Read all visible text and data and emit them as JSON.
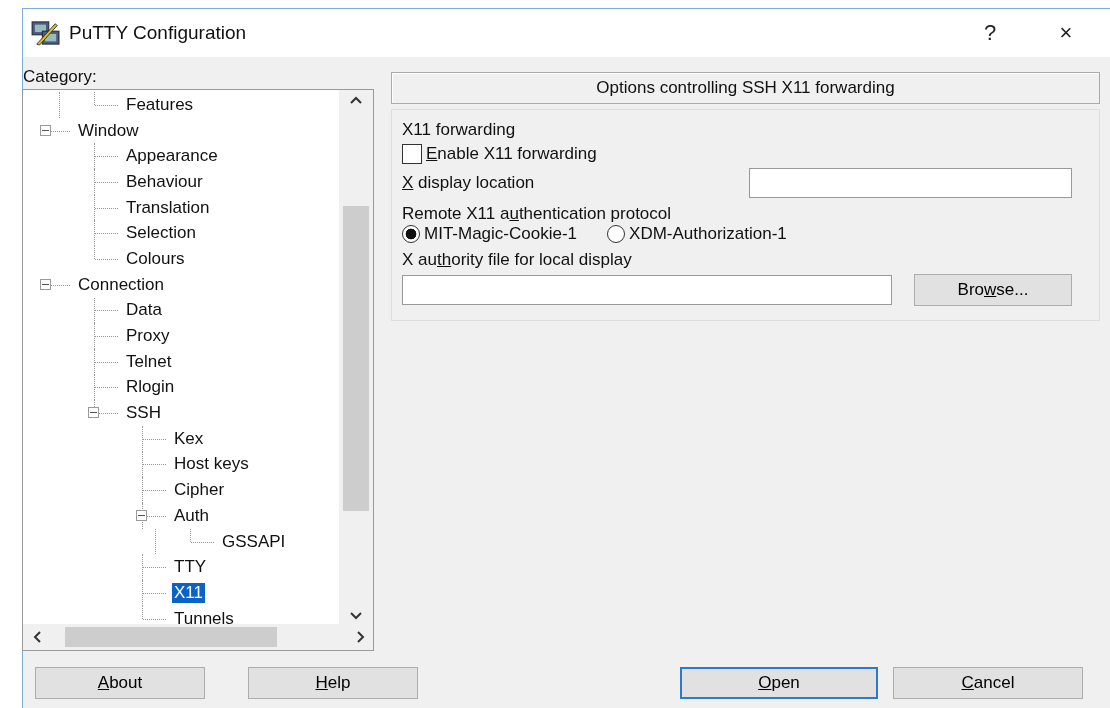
{
  "window": {
    "title": "PuTTY Configuration",
    "help_glyph": "?",
    "close_glyph": "×"
  },
  "category_label": "Category:",
  "tree": {
    "items": [
      {
        "children": [
          {
            "label": "Features",
            "selected": false
          }
        ]
      },
      {
        "label": "Window",
        "expanded": true,
        "selected": false,
        "children": [
          {
            "label": "Appearance",
            "selected": false
          },
          {
            "label": "Behaviour",
            "selected": false
          },
          {
            "label": "Translation",
            "selected": false
          },
          {
            "label": "Selection",
            "selected": false
          },
          {
            "label": "Colours",
            "selected": false
          }
        ]
      },
      {
        "label": "Connection",
        "expanded": true,
        "selected": false,
        "children": [
          {
            "label": "Data",
            "selected": false
          },
          {
            "label": "Proxy",
            "selected": false
          },
          {
            "label": "Telnet",
            "selected": false
          },
          {
            "label": "Rlogin",
            "selected": false
          },
          {
            "label": "SSH",
            "expanded": true,
            "selected": false,
            "children": [
              {
                "label": "Kex",
                "selected": false
              },
              {
                "label": "Host keys",
                "selected": false
              },
              {
                "label": "Cipher",
                "selected": false
              },
              {
                "label": "Auth",
                "expanded": true,
                "selected": false,
                "children": [
                  {
                    "label": "GSSAPI",
                    "selected": false
                  }
                ]
              },
              {
                "label": "TTY",
                "selected": false
              },
              {
                "label": "X11",
                "selected": true
              },
              {
                "label": "Tunnels",
                "selected": false
              }
            ]
          }
        ]
      }
    ]
  },
  "panel": {
    "header": "Options controlling SSH X11 forwarding",
    "group": {
      "title": "X11 forwarding",
      "enable_checkbox": {
        "label": {
          "key": "E",
          "post": "nable X11 forwarding"
        },
        "checked": false
      },
      "display_location": {
        "label": {
          "key": "X",
          "post": " display location"
        }
      },
      "protocol_label": {
        "pre": "Remote X11 a",
        "key": "u",
        "post": "thentication protocol"
      },
      "protocols": [
        {
          "label": "MIT-Magic-Cookie-1",
          "selected": true
        },
        {
          "label": "XDM-Authorization-1",
          "selected": false
        }
      ],
      "authority_label": {
        "pre": "X au",
        "key": "th",
        "post": "ority file for local display"
      },
      "browse_button": {
        "pre": "Bro",
        "key": "w",
        "post": "se..."
      }
    }
  },
  "buttons": [
    {
      "label": {
        "key": "A",
        "post": "bout"
      },
      "default": false
    },
    {
      "label": {
        "key": "H",
        "post": "elp"
      },
      "default": false
    },
    {
      "label": {
        "key": "O",
        "post": "pen"
      },
      "default": true
    },
    {
      "label": {
        "key": "C",
        "post": "ancel"
      },
      "default": false
    }
  ]
}
